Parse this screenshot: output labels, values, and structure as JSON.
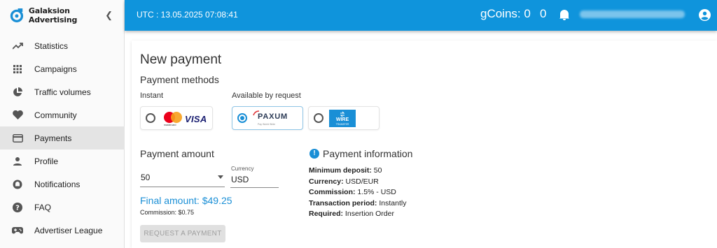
{
  "brand": {
    "name": "Galaksion Advertising",
    "collapse_icon": "chevron-left-icon"
  },
  "sidebar": {
    "items": [
      {
        "label": "Statistics",
        "icon": "trending-up-icon"
      },
      {
        "label": "Campaigns",
        "icon": "grid-icon"
      },
      {
        "label": "Traffic volumes",
        "icon": "pie-chart-icon"
      },
      {
        "label": "Community",
        "icon": "heart-icon"
      },
      {
        "label": "Payments",
        "icon": "credit-card-icon",
        "active": true
      },
      {
        "label": "Profile",
        "icon": "person-icon"
      },
      {
        "label": "Notifications",
        "icon": "notification-icon"
      },
      {
        "label": "FAQ",
        "icon": "help-icon"
      },
      {
        "label": "Advertiser League",
        "icon": "gamepad-icon"
      }
    ]
  },
  "topbar": {
    "utc": "UTC : 13.05.2025 07:08:41",
    "gcoins": "gCoins: 0",
    "coins_count": "0",
    "bell_icon": "bell-icon",
    "account_icon": "account-icon",
    "accent": "#0f94dc"
  },
  "main": {
    "title": "New payment",
    "payment_methods": {
      "heading": "Payment methods",
      "instant_label": "Instant",
      "request_label": "Available by request",
      "methods": [
        {
          "name": "Mastercard / VISA",
          "mc_text": "mastercard",
          "visa_text": "VISA",
          "selected": false
        },
        {
          "name": "PAXUM",
          "logo_text": "PAXUM",
          "tagline": "Pay World Wide",
          "selected": true
        },
        {
          "name": "WIRE transfer",
          "logo_text": "WIRE",
          "logo_sub": "TRANSFER",
          "selected": false
        }
      ]
    },
    "payment_amount": {
      "heading": "Payment amount",
      "amount_value": "50",
      "currency_label": "Currency",
      "currency_value": "USD",
      "final_amount": "Final amount: $49.25",
      "commission": "Commission: $0.75",
      "request_button": "REQUEST A PAYMENT"
    },
    "payment_information": {
      "heading": "Payment information",
      "rows": [
        {
          "label": "Minimum deposit:",
          "value": " 50"
        },
        {
          "label": "Currency:",
          "value": " USD/EUR"
        },
        {
          "label": "Commission:",
          "value": " 1.5% - USD"
        },
        {
          "label": "Transaction period:",
          "value": " Instantly"
        },
        {
          "label": "Required:",
          "value": " Insertion Order"
        }
      ]
    }
  }
}
